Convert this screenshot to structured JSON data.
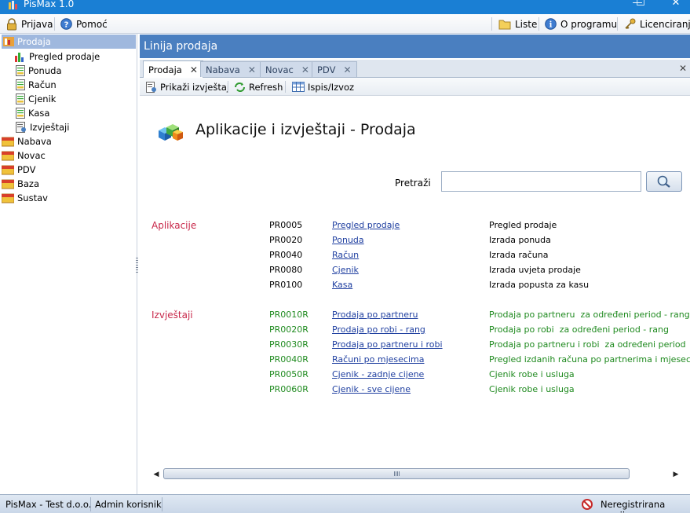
{
  "window": {
    "title": "PisMax 1.0",
    "minimize": "—",
    "maximize": "☐",
    "close": "✕"
  },
  "menubar": {
    "left": [
      {
        "label": "Prijava",
        "icon": "lock-icon"
      },
      {
        "label": "Pomoć",
        "icon": "help-icon"
      }
    ],
    "right": [
      {
        "label": "Liste",
        "icon": "folder-icon"
      },
      {
        "label": "O programu",
        "icon": "info-icon"
      },
      {
        "label": "Licenciranje",
        "icon": "key-icon"
      }
    ]
  },
  "sidebar": {
    "items": [
      {
        "label": "Prodaja",
        "icon": "module-icon",
        "selected": true,
        "level": 0
      },
      {
        "label": "Pregled prodaje",
        "icon": "chart-icon",
        "level": 1
      },
      {
        "label": "Ponuda",
        "icon": "document-icon",
        "level": 1
      },
      {
        "label": "Račun",
        "icon": "document-icon",
        "level": 1
      },
      {
        "label": "Cjenik",
        "icon": "document-icon",
        "level": 1
      },
      {
        "label": "Kasa",
        "icon": "document-icon",
        "level": 1
      },
      {
        "label": "Izvještaji",
        "icon": "report-icon",
        "level": 1
      },
      {
        "label": "Nabava",
        "icon": "module-icon",
        "level": 0
      },
      {
        "label": "Novac",
        "icon": "module-icon",
        "level": 0
      },
      {
        "label": "PDV",
        "icon": "module-icon",
        "level": 0
      },
      {
        "label": "Baza",
        "icon": "module-icon",
        "level": 0
      },
      {
        "label": "Sustav",
        "icon": "module-icon",
        "level": 0
      }
    ]
  },
  "panel": {
    "header": "Linija prodaja",
    "tabs": [
      {
        "label": "Prodaja",
        "active": true
      },
      {
        "label": "Nabava",
        "active": false
      },
      {
        "label": "Novac",
        "active": false
      },
      {
        "label": "PDV",
        "active": false
      }
    ],
    "tab_close": "✕",
    "toolbar": [
      {
        "label": "Prikaži izvještaj",
        "icon": "report-view-icon"
      },
      {
        "label": "Refresh",
        "icon": "refresh-icon"
      },
      {
        "label": "Ispis/Izvoz",
        "icon": "table-icon"
      }
    ]
  },
  "content": {
    "title": "Aplikacije i izvještaji - Prodaja",
    "search_label": "Pretraži",
    "search_value": "",
    "applications_label": "Aplikacije",
    "applications": [
      {
        "code": "PR0005",
        "name": "Pregled prodaje",
        "desc": "Pregled prodaje"
      },
      {
        "code": "PR0020",
        "name": "Ponuda",
        "desc": "Izrada ponuda"
      },
      {
        "code": "PR0040",
        "name": "Račun",
        "desc": "Izrada računa"
      },
      {
        "code": "PR0080",
        "name": "Cjenik",
        "desc": "Izrada uvjeta prodaje"
      },
      {
        "code": "PR0100",
        "name": "Kasa",
        "desc": "Izrada popusta za kasu"
      }
    ],
    "reports_label": "Izvještaji",
    "reports": [
      {
        "code": "PR0010R",
        "name": "Prodaja po partneru",
        "desc": "Prodaja po partneru  za određeni period - rang"
      },
      {
        "code": "PR0020R",
        "name": "Prodaja po robi - rang",
        "desc": "Prodaja po robi  za određeni period - rang"
      },
      {
        "code": "PR0030R",
        "name": "Prodaja po partneru i robi ",
        "desc": "Prodaja po partneru i robi  za određeni period"
      },
      {
        "code": "PR0040R",
        "name": "Računi po mjesecima",
        "desc": "Pregled izdanih računa po partnerima i mjesecima"
      },
      {
        "code": "PR0050R",
        "name": "Cjenik - zadnje cijene",
        "desc": "Cjenik robe i usluga"
      },
      {
        "code": "PR0060R",
        "name": "Cjenik - sve cijene",
        "desc": "Cjenik robe i usluga"
      }
    ]
  },
  "statusbar": {
    "company": "PisMax - Test d.o.o.",
    "user": "Admin korisnik",
    "license": "Neregistrirana verzija"
  },
  "colors": {
    "titlebar": "#1a7fd4",
    "panel_header": "#4a7fc0",
    "section_label": "#c8284a",
    "report_text": "#1f8a1f",
    "link": "#1f3fa0",
    "sidebar_selected": "#9fb8de"
  }
}
